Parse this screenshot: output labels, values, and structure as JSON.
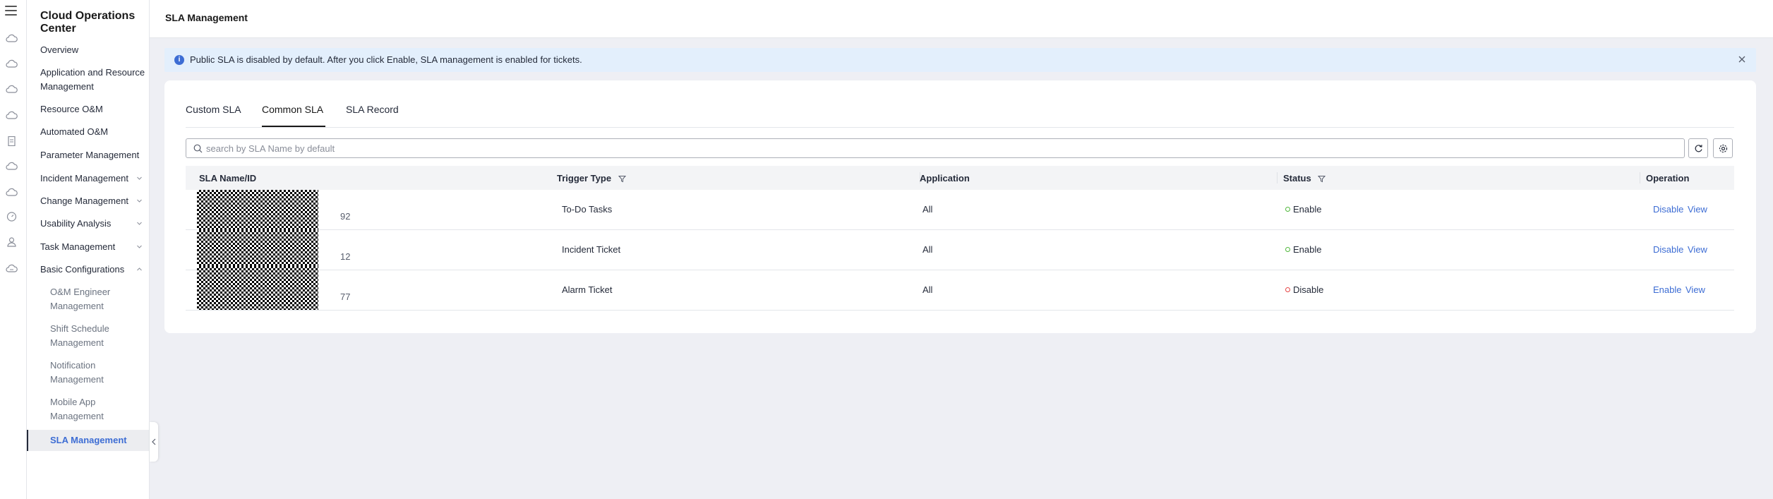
{
  "app": {
    "title": "Cloud Operations Center"
  },
  "header": {
    "page_title": "SLA Management"
  },
  "rail_icons": [
    "cloud-icon",
    "cloud-icon",
    "cloud-icon",
    "cloud-icon",
    "document-icon",
    "cloud-icon",
    "cloud-icon",
    "gauge-icon",
    "user-icon",
    "cloud-icon"
  ],
  "sidebar": {
    "items": [
      {
        "label": "Overview"
      },
      {
        "label": "Application and Resource Management"
      },
      {
        "label": "Resource O&M"
      },
      {
        "label": "Automated O&M"
      },
      {
        "label": "Parameter Management"
      },
      {
        "label": "Incident Management"
      },
      {
        "label": "Change Management"
      },
      {
        "label": "Usability Analysis"
      },
      {
        "label": "Task Management"
      },
      {
        "label": "Basic Configurations"
      }
    ],
    "sub_items": [
      {
        "label": "O&M Engineer Management"
      },
      {
        "label": "Shift Schedule Management"
      },
      {
        "label": "Notification Management"
      },
      {
        "label": "Mobile App Management"
      }
    ],
    "active_item": "SLA Management"
  },
  "banner": {
    "message": "Public SLA is disabled by default. After you click Enable, SLA management is enabled for tickets."
  },
  "tabs": [
    {
      "label": "Custom SLA"
    },
    {
      "label": "Common SLA"
    },
    {
      "label": "SLA Record"
    }
  ],
  "active_tab": "Common SLA",
  "search": {
    "placeholder": "search by SLA Name by default",
    "value": ""
  },
  "table": {
    "columns": [
      "SLA Name/ID",
      "Trigger Type",
      "Application",
      "Status",
      "Operation"
    ],
    "rows": [
      {
        "id_suffix": "92",
        "trigger_type": "To-Do Tasks",
        "application": "All",
        "status": "Enable",
        "status_color": "#50b83c",
        "actions": [
          "Disable",
          "View"
        ]
      },
      {
        "id_suffix": "12",
        "trigger_type": "Incident Ticket",
        "application": "All",
        "status": "Enable",
        "status_color": "#50b83c",
        "actions": [
          "Disable",
          "View"
        ]
      },
      {
        "id_suffix": "77",
        "trigger_type": "Alarm Ticket",
        "application": "All",
        "status": "Disable",
        "status_color": "#e54545",
        "actions": [
          "Enable",
          "View"
        ]
      }
    ]
  },
  "colors": {
    "accent": "#3d6dd4",
    "banner_bg": "#e3effc",
    "enabled": "#50b83c",
    "disabled": "#e54545"
  }
}
